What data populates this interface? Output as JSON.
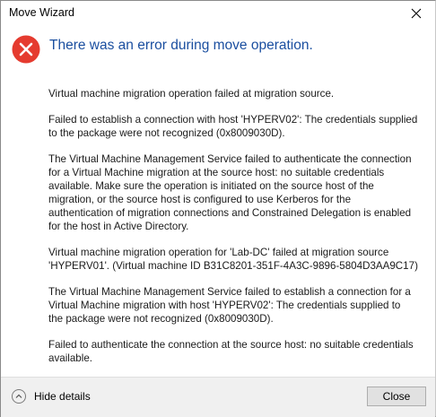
{
  "window": {
    "title": "Move Wizard",
    "close_icon": "close-icon"
  },
  "dialog": {
    "icon": "error-icon",
    "icon_color": "#e81123",
    "heading": "There was an error during move operation.",
    "heading_color": "#1b4fa0",
    "messages": [
      "Virtual machine migration operation failed at migration source.",
      "Failed to establish a connection with host 'HYPERV02': The credentials supplied\nto the package were not recognized (0x8009030D).",
      "The Virtual Machine Management Service failed to authenticate the connection\nfor a Virtual Machine migration at the source host: no suitable credentials\navailable. Make sure the operation is initiated on the source host of the\nmigration, or the source host is configured to use Kerberos for the\nauthentication of migration connections and Constrained Delegation is enabled\nfor the host in Active Directory.",
      "Virtual machine migration operation for 'Lab-DC' failed at migration source\n'HYPERV01'. (Virtual machine ID B31C8201-351F-4A3C-9896-5804D3AA9C17)",
      "The Virtual Machine Management Service failed to establish a connection for a\nVirtual Machine migration with host 'HYPERV02': The credentials supplied to\nthe package were not recognized (0x8009030D).",
      "Failed to authenticate the connection at the source host: no suitable credentials\navailable."
    ]
  },
  "footer": {
    "details_label": "Hide details",
    "details_icon": "chevron-up-icon",
    "close_label": "Close"
  }
}
